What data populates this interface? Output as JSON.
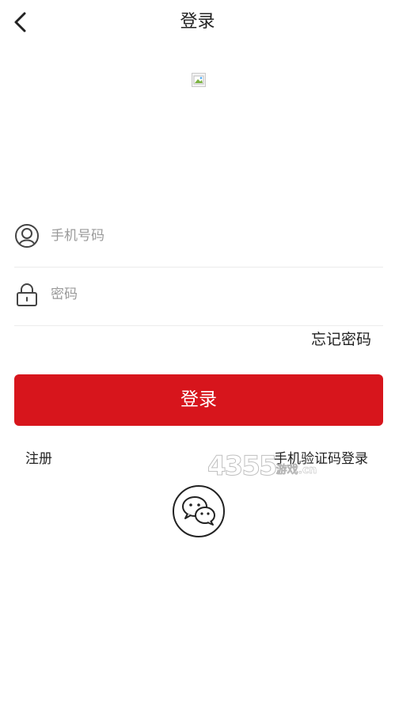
{
  "header": {
    "title": "登录",
    "back_icon": "chevron-left-icon"
  },
  "logo": {
    "icon": "broken-image-icon"
  },
  "form": {
    "phone": {
      "placeholder": "手机号码",
      "value": "",
      "icon": "user-circle-icon"
    },
    "password": {
      "placeholder": "密码",
      "value": "",
      "icon": "lock-icon"
    },
    "forgot_label": "忘记密码"
  },
  "login_button": {
    "label": "登录",
    "color": "#d7151c"
  },
  "links": {
    "register": "注册",
    "sms_login": "手机验证码登录"
  },
  "social": {
    "wechat_icon": "wechat-icon"
  },
  "watermark": {
    "text": "4355",
    "suffix": "游戏.cn"
  }
}
